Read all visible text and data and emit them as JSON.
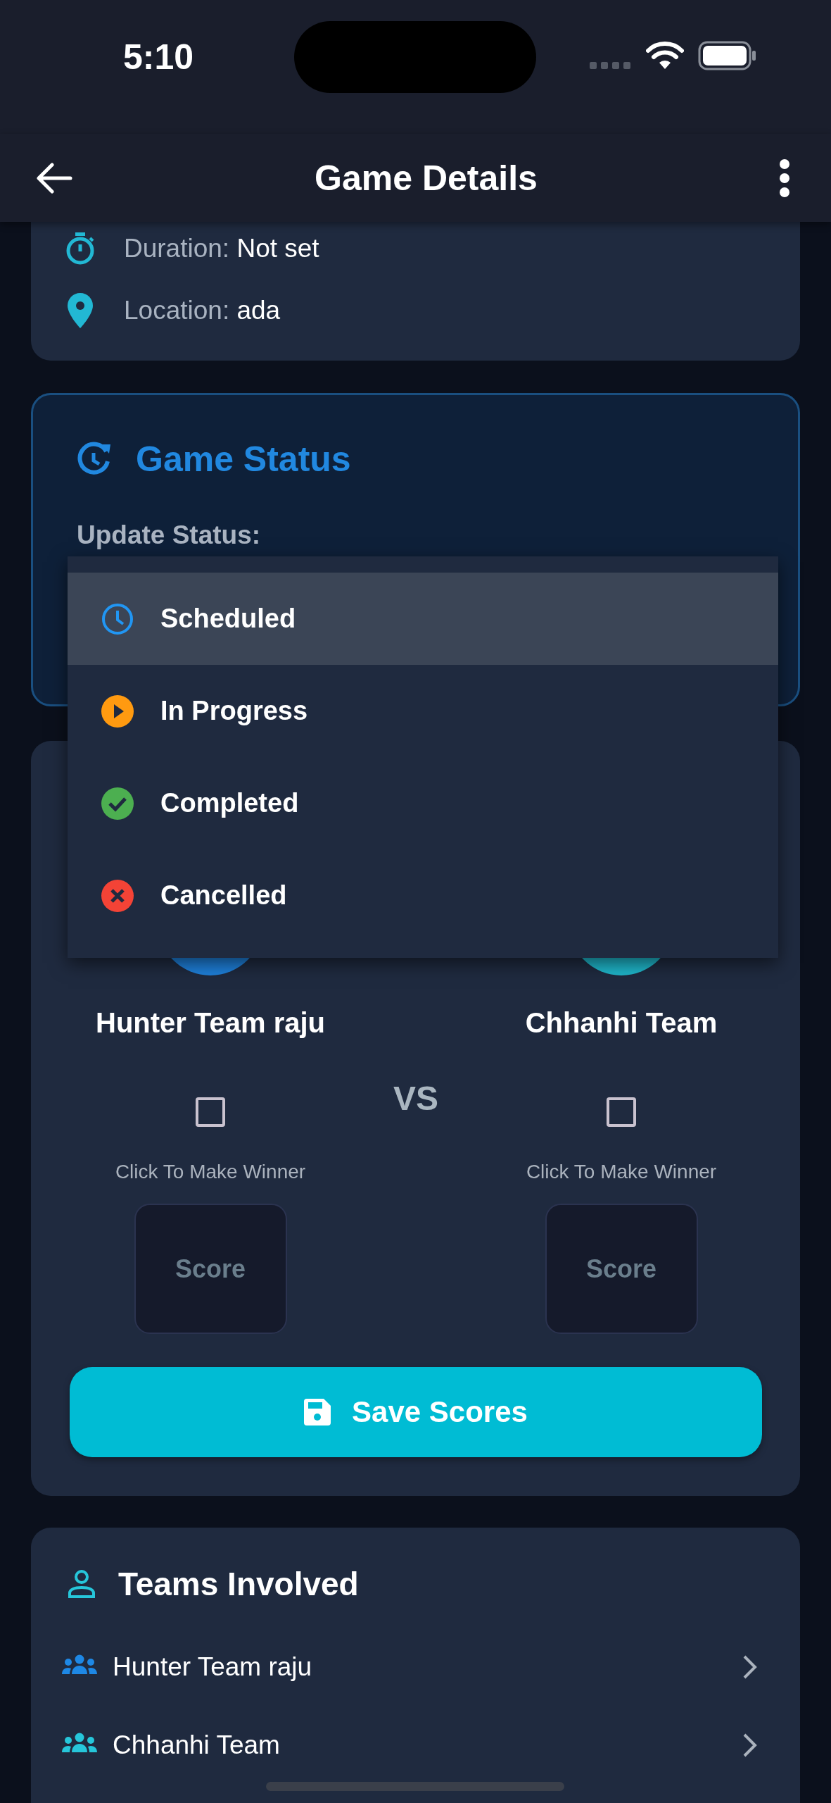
{
  "status_bar": {
    "time": "5:10"
  },
  "header": {
    "title": "Game Details"
  },
  "details": [
    {
      "kind": "duration",
      "label": "Duration:",
      "value": "Not set"
    },
    {
      "kind": "location",
      "label": "Location:",
      "value": "ada"
    }
  ],
  "game_status": {
    "title": "Game Status",
    "label": "Update Status:",
    "menu": [
      {
        "kind": "scheduled",
        "label": "Scheduled",
        "selected": true
      },
      {
        "kind": "in_progress",
        "label": "In Progress",
        "selected": false
      },
      {
        "kind": "completed",
        "label": "Completed",
        "selected": false
      },
      {
        "kind": "cancelled",
        "label": "Cancelled",
        "selected": false
      }
    ]
  },
  "score": {
    "teams": [
      {
        "name": "Hunter Team raju",
        "color": "#1e7fd8",
        "checked": false,
        "winner_label": "Click To Make Winner",
        "score_placeholder": "Score"
      },
      {
        "name": "Chhanhi Team",
        "color": "#1fb5c9",
        "checked": false,
        "winner_label": "Click To Make Winner",
        "score_placeholder": "Score"
      }
    ],
    "vs": "VS",
    "save_button": "Save Scores"
  },
  "teams_involved": {
    "title": "Teams Involved",
    "teams": [
      {
        "name": "Hunter Team raju",
        "color": "#1e88e5"
      },
      {
        "name": "Chhanhi Team",
        "color": "#26c6da"
      }
    ]
  }
}
